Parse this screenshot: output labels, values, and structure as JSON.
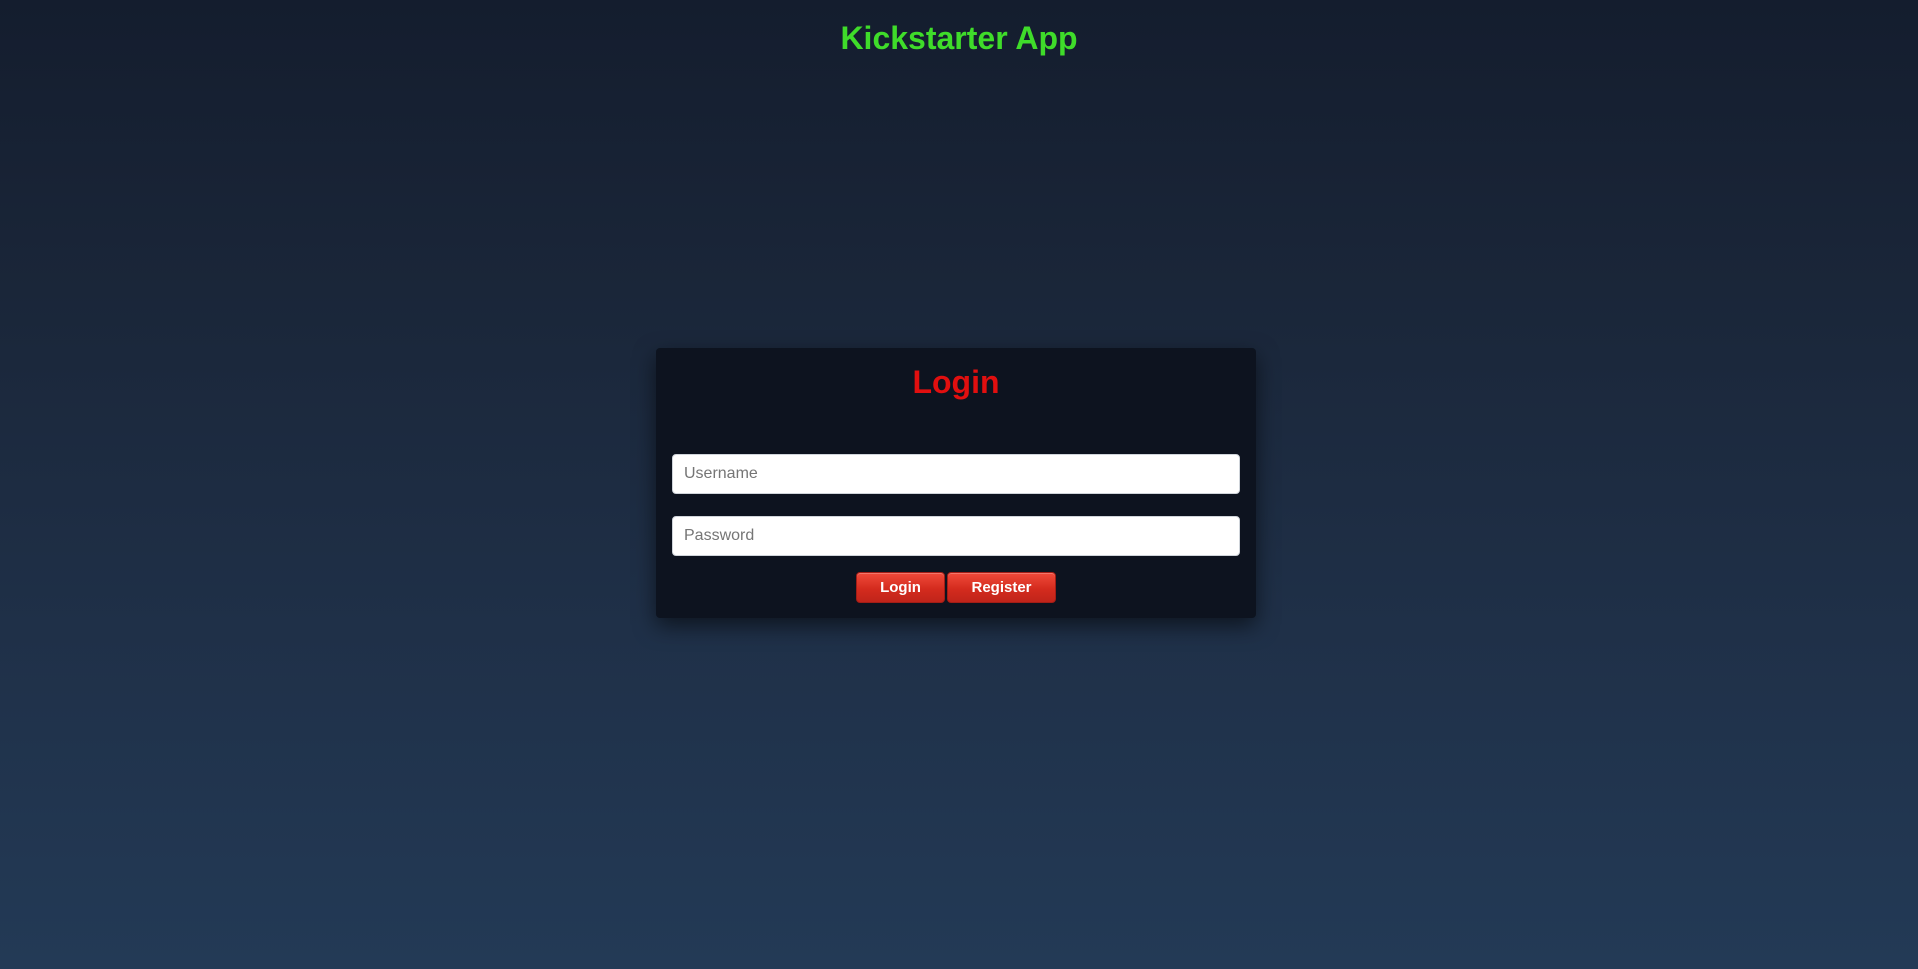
{
  "app": {
    "title": "Kickstarter App"
  },
  "login_form": {
    "heading": "Login",
    "username": {
      "value": "",
      "placeholder": "Username"
    },
    "password": {
      "value": "",
      "placeholder": "Password"
    },
    "buttons": {
      "login_label": "Login",
      "register_label": "Register"
    }
  },
  "colors": {
    "title_green": "#3fdc2a",
    "heading_red": "#e10f0f",
    "button_red": "#d42b1e",
    "card_background": "#0d131f",
    "page_background_top": "#141d2e",
    "page_background_bottom": "#233a56"
  }
}
